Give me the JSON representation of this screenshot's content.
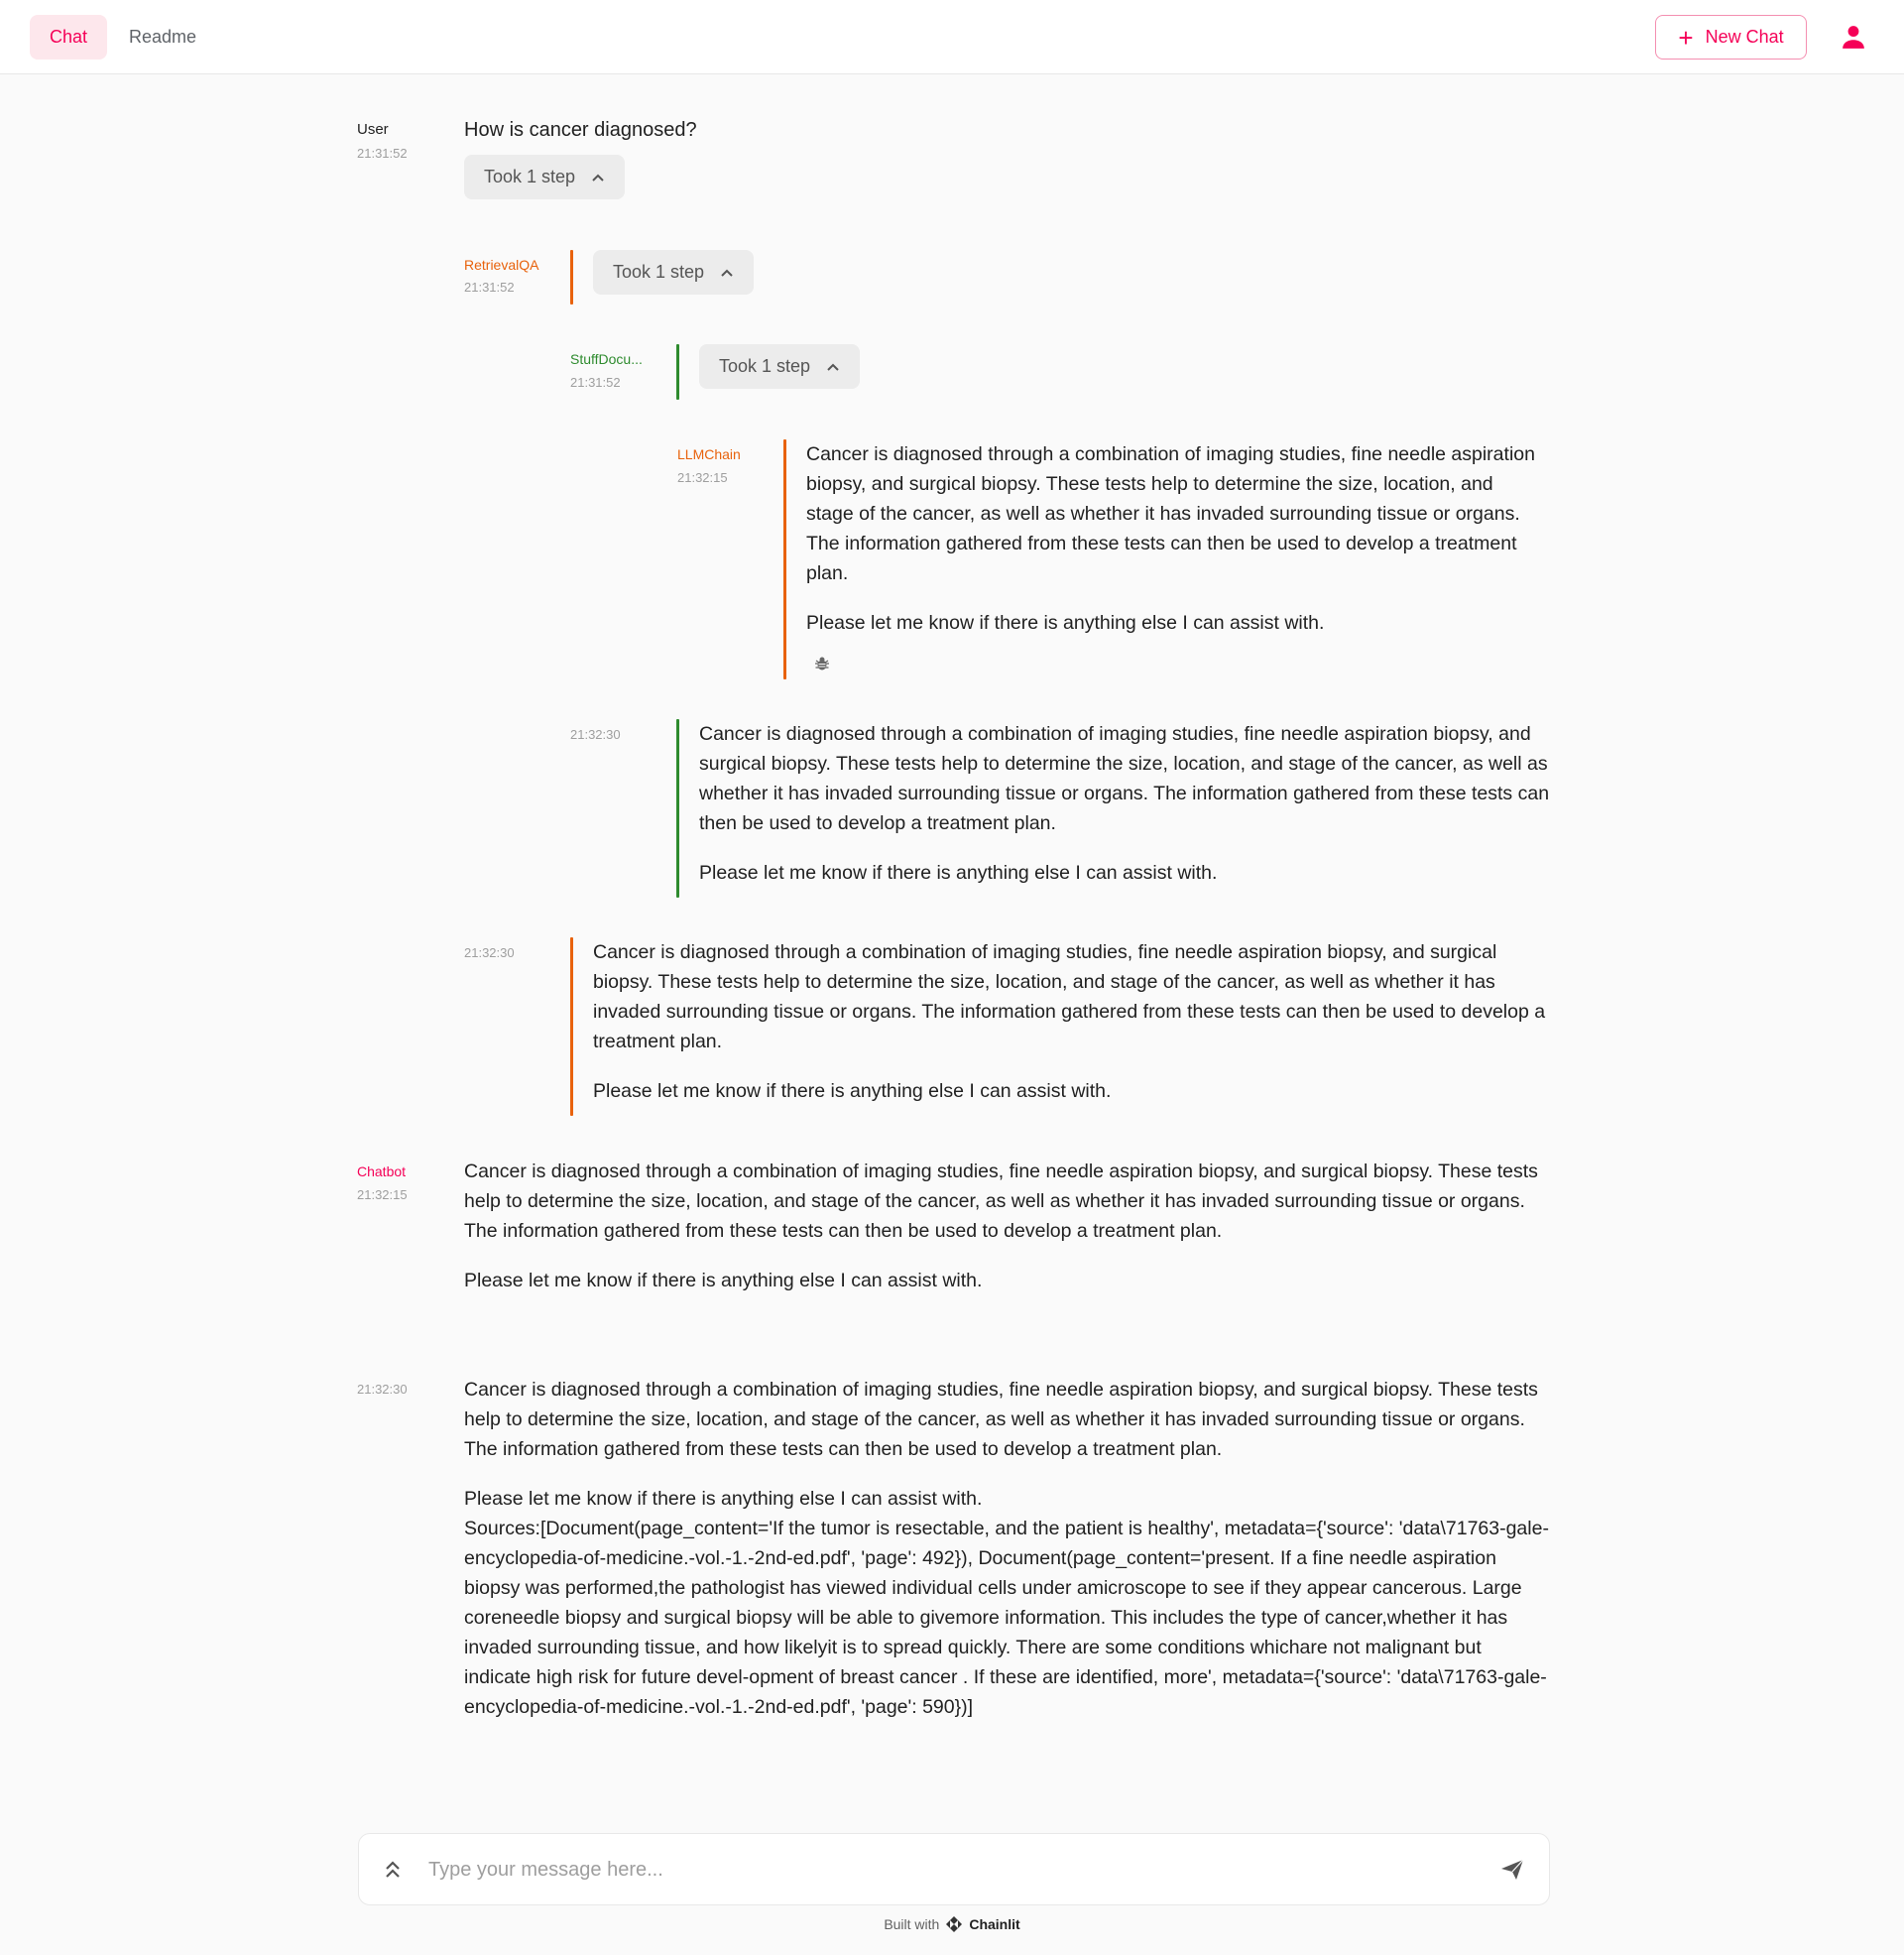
{
  "header": {
    "tabs": [
      {
        "label": "Chat",
        "active": true
      },
      {
        "label": "Readme",
        "active": false
      }
    ],
    "new_chat_label": "New Chat",
    "accent_color": "#f50057"
  },
  "messages": {
    "user": {
      "author": "User",
      "time": "21:31:52",
      "text": "How is cancer diagnosed?",
      "steps_label": "Took 1 step"
    },
    "retrieval": {
      "author": "RetrievalQA",
      "time": "21:31:52",
      "steps_label": "Took 1 step"
    },
    "stuff": {
      "author": "StuffDocu...",
      "time": "21:31:52",
      "steps_label": "Took 1 step"
    },
    "llmchain": {
      "author": "LLMChain",
      "time": "21:32:15",
      "p1": "Cancer is diagnosed through a combination of imaging studies, fine needle aspiration biopsy, and surgical biopsy. These tests help to determine the size, location, and stage of the cancer, as well as whether it has invaded surrounding tissue or organs. The information gathered from these tests can then be used to develop a treatment plan.",
      "p2": "Please let me know if there is anything else I can assist with."
    },
    "stuff_output": {
      "time": "21:32:30",
      "p1": "Cancer is diagnosed through a combination of imaging studies, fine needle aspiration biopsy, and surgical biopsy. These tests help to determine the size, location, and stage of the cancer, as well as whether it has invaded surrounding tissue or organs. The information gathered from these tests can then be used to develop a treatment plan.",
      "p2": "Please let me know if there is anything else I can assist with."
    },
    "retrieval_output": {
      "time": "21:32:30",
      "p1": "Cancer is diagnosed through a combination of imaging studies, fine needle aspiration biopsy, and surgical biopsy. These tests help to determine the size, location, and stage of the cancer, as well as whether it has invaded surrounding tissue or organs. The information gathered from these tests can then be used to develop a treatment plan.",
      "p2": "Please let me know if there is anything else I can assist with."
    },
    "chatbot": {
      "author": "Chatbot",
      "time": "21:32:15",
      "p1": "Cancer is diagnosed through a combination of imaging studies, fine needle aspiration biopsy, and surgical biopsy. These tests help to determine the size, location, and stage of the cancer, as well as whether it has invaded surrounding tissue or organs. The information gathered from these tests can then be used to develop a treatment plan.",
      "p2": "Please let me know if there is anything else I can assist with."
    },
    "final": {
      "time": "21:32:30",
      "p1": "Cancer is diagnosed through a combination of imaging studies, fine needle aspiration biopsy, and surgical biopsy. These tests help to determine the size, location, and stage of the cancer, as well as whether it has invaded surrounding tissue or organs. The information gathered from these tests can then be used to develop a treatment plan.",
      "p2": "Please let me know if there is anything else I can assist with.",
      "sources": "Sources:[Document(page_content='If the tumor is resectable, and the patient is healthy', metadata={'source': 'data\\71763-gale-encyclopedia-of-medicine.-vol.-1.-2nd-ed.pdf', 'page': 492}), Document(page_content='present. If a fine needle aspiration biopsy was performed,the pathologist has viewed individual cells under amicroscope to see if they appear cancerous. Large coreneedle biopsy and surgical biopsy will be able to givemore information. This includes the type of cancer,whether it has invaded surrounding tissue, and how likelyit is to spread quickly. There are some conditions whichare not malignant but indicate high risk for future devel-opment of breast cancer . If these are identified, more', metadata={'source': 'data\\71763-gale-encyclopedia-of-medicine.-vol.-1.-2nd-ed.pdf', 'page': 590})]"
    }
  },
  "composer": {
    "placeholder": "Type your message here...",
    "value": ""
  },
  "footer": {
    "built_with": "Built with",
    "brand": "Chainlit"
  },
  "colors": {
    "retrieval": "#e8620c",
    "stuff": "#2e8b2e",
    "llmchain": "#e8620c",
    "chatbot": "#f50057",
    "user": "#212121"
  }
}
